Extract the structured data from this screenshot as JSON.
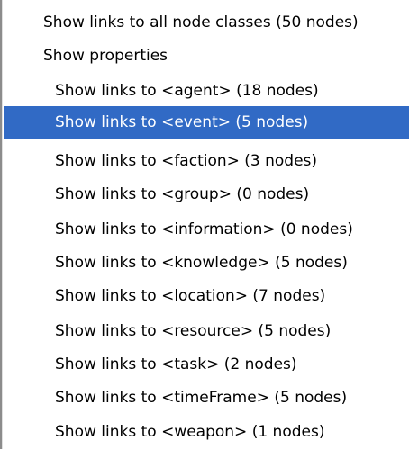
{
  "menu": {
    "top_items": [
      {
        "label": "Show links to all node classes (50 nodes)"
      },
      {
        "label": "Show properties"
      }
    ],
    "sub_items": [
      {
        "label": "Show links to <agent>  (18 nodes)",
        "selected": false
      },
      {
        "label": "Show links to <event>  (5 nodes)",
        "selected": true
      },
      {
        "label": "Show links to <faction>  (3 nodes)",
        "selected": false
      },
      {
        "label": "Show links to <group>  (0 nodes)",
        "selected": false
      },
      {
        "label": "Show links to <information>  (0 nodes)",
        "selected": false
      },
      {
        "label": "Show links to <knowledge>  (5 nodes)",
        "selected": false
      },
      {
        "label": "Show links to <location>  (7 nodes)",
        "selected": false
      },
      {
        "label": "Show links to <resource>  (5 nodes)",
        "selected": false
      },
      {
        "label": "Show links to <task>  (2 nodes)",
        "selected": false
      },
      {
        "label": "Show links to <timeFrame>  (5 nodes)",
        "selected": false
      },
      {
        "label": "Show links to <weapon>  (1 nodes)",
        "selected": false
      }
    ],
    "selection_color": "#316ac5",
    "selected_text_color": "#ffffff",
    "text_color": "#000000"
  }
}
